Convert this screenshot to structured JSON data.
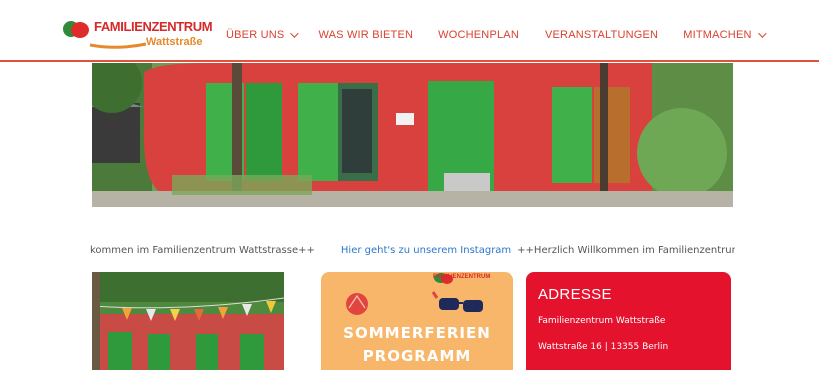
{
  "logo": {
    "title": "FAMILIENZENTRUM",
    "subtitle": "Wattstraße",
    "icon": "familienzentrum-logo"
  },
  "nav": {
    "items": [
      {
        "label": "ÜBER UNS",
        "has_dropdown": true
      },
      {
        "label": "WAS WIR BIETEN",
        "has_dropdown": false
      },
      {
        "label": "WOCHENPLAN",
        "has_dropdown": false
      },
      {
        "label": "VERANSTALTUNGEN",
        "has_dropdown": false
      },
      {
        "label": "MITMACHEN",
        "has_dropdown": true
      }
    ]
  },
  "ticker": {
    "left_text": "kommen im Familienzentrum Wattstrasse++",
    "link_text": "Hier geht's zu unserem Instagram",
    "right_text": "++Herzlich Willkommen im Familienzentrum Wattst"
  },
  "promo": {
    "logo_text": "FAMILIENZENTRUM",
    "title_line1": "SOMMERFERIEN",
    "title_line2": "PROGRAMM"
  },
  "address": {
    "title": "ADRESSE",
    "line1": "Familienzentrum Wattstraße",
    "line2": "Wattstraße 16 | 13355 Berlin"
  },
  "colors": {
    "accent_red": "#d9412f",
    "address_bg": "#e4122d",
    "promo_bg": "#f8b66b",
    "link_blue": "#2a78c8"
  }
}
